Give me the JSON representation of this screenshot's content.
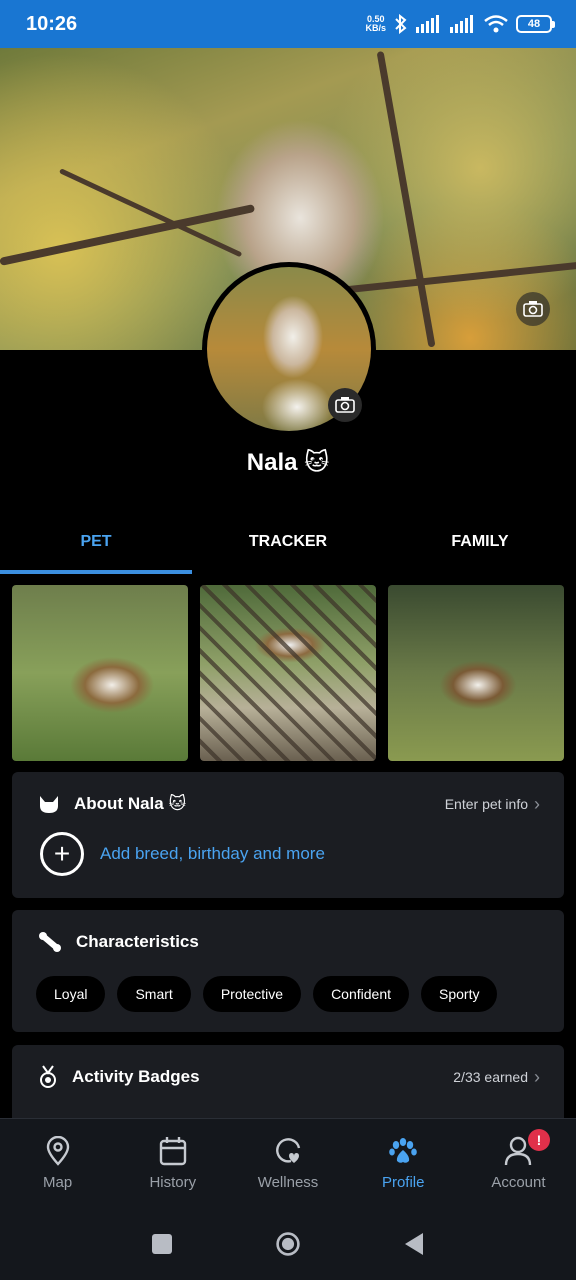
{
  "status_bar": {
    "time": "10:26",
    "net_speed_value": "0.50",
    "net_speed_unit": "KB/s",
    "battery": "48"
  },
  "profile": {
    "pet_name": "Nala 🐱"
  },
  "tabs": [
    {
      "label": "PET",
      "active": true
    },
    {
      "label": "TRACKER",
      "active": false
    },
    {
      "label": "FAMILY",
      "active": false
    }
  ],
  "about": {
    "title": "About Nala 🐱",
    "link": "Enter pet info",
    "add_text": "Add breed, birthday and more"
  },
  "characteristics": {
    "title": "Characteristics",
    "chips": [
      "Loyal",
      "Smart",
      "Protective",
      "Confident",
      "Sporty"
    ]
  },
  "badges": {
    "title": "Activity Badges",
    "earned": "2/33 earned"
  },
  "bottom_nav": [
    {
      "label": "Map",
      "icon": "map-pin-icon"
    },
    {
      "label": "History",
      "icon": "calendar-icon"
    },
    {
      "label": "Wellness",
      "icon": "wellness-icon"
    },
    {
      "label": "Profile",
      "icon": "paw-icon",
      "active": true
    },
    {
      "label": "Account",
      "icon": "user-icon",
      "alert": "!"
    }
  ],
  "colors": {
    "status_bar": "#1976d2",
    "accent": "#4aa3f0",
    "card_bg": "#1b1d22",
    "alert": "#e0304a"
  }
}
